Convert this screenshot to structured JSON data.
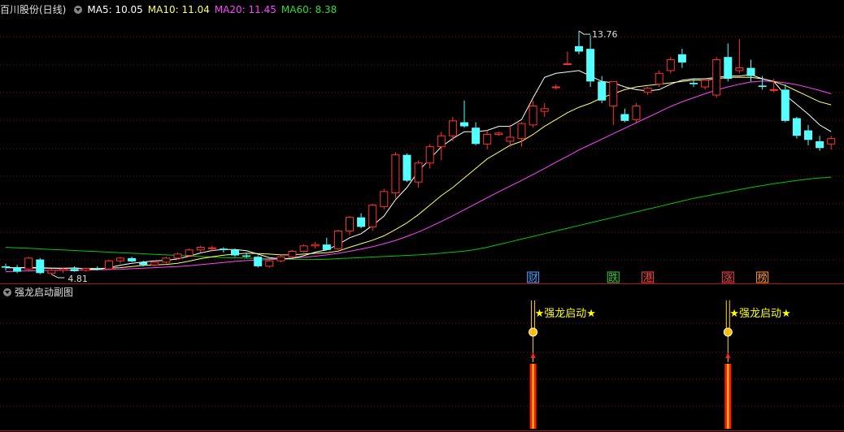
{
  "header": {
    "stock_title": "百川股份(日线)",
    "ma5": "MA5: 10.05",
    "ma10": "MA10: 11.04",
    "ma20": "MA20: 11.45",
    "ma60": "MA60: 8.38"
  },
  "lower_panel": {
    "title": "强龙启动副图"
  },
  "colors": {
    "up": "#ff3232",
    "down": "#54ffff",
    "ma5": "#ffffff",
    "ma10": "#ffff66",
    "ma20": "#ff44ff",
    "ma60": "#00c800",
    "grid": "#7a1010",
    "signal_text": "#ffff00"
  },
  "chart_data": {
    "type": "candlestick",
    "candles": [
      [
        5.1,
        5.2,
        4.95,
        5.05
      ],
      [
        5.05,
        5.15,
        4.85,
        4.9
      ],
      [
        5.0,
        5.45,
        4.9,
        5.4
      ],
      [
        5.35,
        5.4,
        4.81,
        4.85
      ],
      [
        4.85,
        5.0,
        4.8,
        4.95
      ],
      [
        4.95,
        5.05,
        4.85,
        5.0
      ],
      [
        5.0,
        5.1,
        4.9,
        4.92
      ],
      [
        4.95,
        5.05,
        4.9,
        5.02
      ],
      [
        5.02,
        5.1,
        4.95,
        5.0
      ],
      [
        5.0,
        5.35,
        4.98,
        5.3
      ],
      [
        5.3,
        5.45,
        5.2,
        5.4
      ],
      [
        5.4,
        5.45,
        5.25,
        5.28
      ],
      [
        5.25,
        5.3,
        5.1,
        5.15
      ],
      [
        5.15,
        5.3,
        5.1,
        5.25
      ],
      [
        5.25,
        5.45,
        5.2,
        5.4
      ],
      [
        5.4,
        5.6,
        5.35,
        5.55
      ],
      [
        5.5,
        5.75,
        5.45,
        5.7
      ],
      [
        5.7,
        5.85,
        5.6,
        5.8
      ],
      [
        5.75,
        5.85,
        5.65,
        5.78
      ],
      [
        5.75,
        5.8,
        5.6,
        5.7
      ],
      [
        5.7,
        5.75,
        5.45,
        5.5
      ],
      [
        5.5,
        5.6,
        5.4,
        5.45
      ],
      [
        5.45,
        5.5,
        5.05,
        5.1
      ],
      [
        5.1,
        5.35,
        5.05,
        5.3
      ],
      [
        5.3,
        5.5,
        5.25,
        5.45
      ],
      [
        5.45,
        5.7,
        5.4,
        5.65
      ],
      [
        5.65,
        5.9,
        5.6,
        5.85
      ],
      [
        5.85,
        6.0,
        5.75,
        5.9
      ],
      [
        5.9,
        6.15,
        5.8,
        5.7
      ],
      [
        5.75,
        6.45,
        5.7,
        6.4
      ],
      [
        6.4,
        6.95,
        6.25,
        6.9
      ],
      [
        6.9,
        7.05,
        6.5,
        6.55
      ],
      [
        6.55,
        7.4,
        6.4,
        7.35
      ],
      [
        7.3,
        7.95,
        7.2,
        7.85
      ],
      [
        7.8,
        9.3,
        7.6,
        9.2
      ],
      [
        9.2,
        9.25,
        8.2,
        8.25
      ],
      [
        8.2,
        9.0,
        8.0,
        8.9
      ],
      [
        8.9,
        9.6,
        8.7,
        9.5
      ],
      [
        9.5,
        10.05,
        9.0,
        9.9
      ],
      [
        9.9,
        10.6,
        9.7,
        10.45
      ],
      [
        10.4,
        11.2,
        10.2,
        10.25
      ],
      [
        10.2,
        10.4,
        9.55,
        9.6
      ],
      [
        9.6,
        10.1,
        9.4,
        9.95
      ],
      [
        9.95,
        10.05,
        9.9,
        10.0
      ],
      [
        9.7,
        10.3,
        9.5,
        9.85
      ],
      [
        9.8,
        10.4,
        9.5,
        10.35
      ],
      [
        10.3,
        11.2,
        10.2,
        11.0
      ],
      [
        10.8,
        11.1,
        10.6,
        10.9
      ],
      [
        11.7,
        11.8,
        11.6,
        11.7
      ],
      [
        12.55,
        13.0,
        12.5,
        12.55
      ],
      [
        13.2,
        13.76,
        12.9,
        13.0
      ],
      [
        13.1,
        13.6,
        11.7,
        11.9
      ],
      [
        11.9,
        12.1,
        11.1,
        11.2
      ],
      [
        11.0,
        11.9,
        10.3,
        11.9
      ],
      [
        10.7,
        10.9,
        10.4,
        10.45
      ],
      [
        10.5,
        11.1,
        10.4,
        11.0
      ],
      [
        11.5,
        11.7,
        11.4,
        11.65
      ],
      [
        11.8,
        12.3,
        11.7,
        12.2
      ],
      [
        12.3,
        12.8,
        12.2,
        12.7
      ],
      [
        12.9,
        13.1,
        12.4,
        12.6
      ],
      [
        11.85,
        12.0,
        11.7,
        11.8
      ],
      [
        11.7,
        12.0,
        11.6,
        11.95
      ],
      [
        11.4,
        12.8,
        11.3,
        12.7
      ],
      [
        12.8,
        13.3,
        11.9,
        12.0
      ],
      [
        12.3,
        13.45,
        12.2,
        12.4
      ],
      [
        12.4,
        12.7,
        11.9,
        12.1
      ],
      [
        11.75,
        12.1,
        11.6,
        11.7
      ],
      [
        11.6,
        12.0,
        11.5,
        11.6
      ],
      [
        11.6,
        11.8,
        10.4,
        10.45
      ],
      [
        10.55,
        10.6,
        9.8,
        9.9
      ],
      [
        10.1,
        10.3,
        9.55,
        9.75
      ],
      [
        9.7,
        9.9,
        9.35,
        9.45
      ],
      [
        9.6,
        9.9,
        9.4,
        9.8
      ]
    ],
    "ma5": [
      5.05,
      5.04,
      5.06,
      5.05,
      5.03,
      5.02,
      5.04,
      5.0,
      4.98,
      5.05,
      5.14,
      5.21,
      5.26,
      5.3,
      5.32,
      5.37,
      5.47,
      5.59,
      5.68,
      5.72,
      5.72,
      5.67,
      5.55,
      5.42,
      5.37,
      5.39,
      5.49,
      5.62,
      5.7,
      5.9,
      6.15,
      6.3,
      6.6,
      6.95,
      7.55,
      8.0,
      8.6,
      9.05,
      9.5,
      9.8,
      10.05,
      10.05,
      10.1,
      10.25,
      10.25,
      10.5,
      11.3,
      12.05,
      12.2,
      12.25,
      12.3,
      12.1,
      11.9,
      11.85,
      11.7,
      11.6,
      11.55,
      11.6,
      11.8,
      11.95,
      12.0,
      12.0,
      12.05,
      12.1,
      12.1,
      12.15,
      12.0,
      11.9,
      11.4,
      11.05,
      10.7,
      10.3,
      10.05
    ],
    "ma10": [
      5.05,
      5.05,
      5.04,
      5.03,
      5.03,
      5.03,
      5.03,
      5.02,
      5.02,
      5.03,
      5.05,
      5.09,
      5.13,
      5.15,
      5.17,
      5.21,
      5.29,
      5.38,
      5.45,
      5.51,
      5.55,
      5.58,
      5.57,
      5.55,
      5.52,
      5.52,
      5.55,
      5.58,
      5.6,
      5.66,
      5.8,
      5.93,
      6.06,
      6.22,
      6.45,
      6.7,
      7.0,
      7.35,
      7.7,
      8.0,
      8.35,
      8.7,
      9.05,
      9.3,
      9.55,
      9.7,
      9.95,
      10.25,
      10.5,
      10.75,
      10.95,
      11.1,
      11.3,
      11.45,
      11.6,
      11.7,
      11.75,
      11.8,
      11.85,
      11.9,
      11.95,
      11.95,
      12.0,
      12.05,
      12.05,
      12.05,
      12.0,
      11.9,
      11.75,
      11.55,
      11.35,
      11.15,
      11.04
    ],
    "ma20": [
      4.9,
      4.92,
      4.93,
      4.94,
      4.95,
      4.95,
      4.96,
      4.96,
      4.97,
      4.98,
      4.99,
      5.01,
      5.03,
      5.05,
      5.07,
      5.09,
      5.12,
      5.16,
      5.2,
      5.24,
      5.28,
      5.31,
      5.33,
      5.35,
      5.37,
      5.4,
      5.43,
      5.47,
      5.52,
      5.58,
      5.65,
      5.73,
      5.82,
      5.93,
      6.05,
      6.2,
      6.36,
      6.55,
      6.75,
      6.96,
      7.18,
      7.4,
      7.62,
      7.84,
      8.05,
      8.26,
      8.48,
      8.7,
      8.93,
      9.15,
      9.38,
      9.58,
      9.78,
      9.98,
      10.18,
      10.38,
      10.58,
      10.78,
      10.98,
      11.15,
      11.3,
      11.45,
      11.58,
      11.7,
      11.8,
      11.88,
      11.92,
      11.9,
      11.85,
      11.78,
      11.68,
      11.57,
      11.45
    ],
    "ma60": [
      5.8,
      5.78,
      5.76,
      5.74,
      5.72,
      5.7,
      5.68,
      5.66,
      5.64,
      5.62,
      5.6,
      5.58,
      5.56,
      5.54,
      5.52,
      5.5,
      5.48,
      5.46,
      5.44,
      5.42,
      5.41,
      5.4,
      5.39,
      5.38,
      5.37,
      5.36,
      5.35,
      5.35,
      5.36,
      5.38,
      5.4,
      5.42,
      5.44,
      5.46,
      5.48,
      5.5,
      5.52,
      5.55,
      5.58,
      5.62,
      5.66,
      5.72,
      5.8,
      5.9,
      6.0,
      6.1,
      6.2,
      6.3,
      6.4,
      6.5,
      6.6,
      6.7,
      6.8,
      6.9,
      7.0,
      7.1,
      7.2,
      7.3,
      7.4,
      7.5,
      7.6,
      7.68,
      7.76,
      7.84,
      7.92,
      8.0,
      8.07,
      8.14,
      8.2,
      8.26,
      8.31,
      8.35,
      8.38
    ],
    "annotations": {
      "high_label": "13.76",
      "low_label": "4.81"
    },
    "y_range": [
      4.5,
      14.3
    ],
    "event_tags": [
      {
        "text": "财",
        "color": "#4aa0ff"
      },
      {
        "text": "跌",
        "color": "#33cc33"
      },
      {
        "text": "港",
        "color": "#ff4444"
      },
      {
        "text": "涨",
        "color": "#ff4444"
      },
      {
        "text": "榜",
        "color": "#ff9933"
      }
    ],
    "signals": [
      {
        "label": "★强龙启动★"
      },
      {
        "label": "★强龙启动★"
      }
    ]
  }
}
